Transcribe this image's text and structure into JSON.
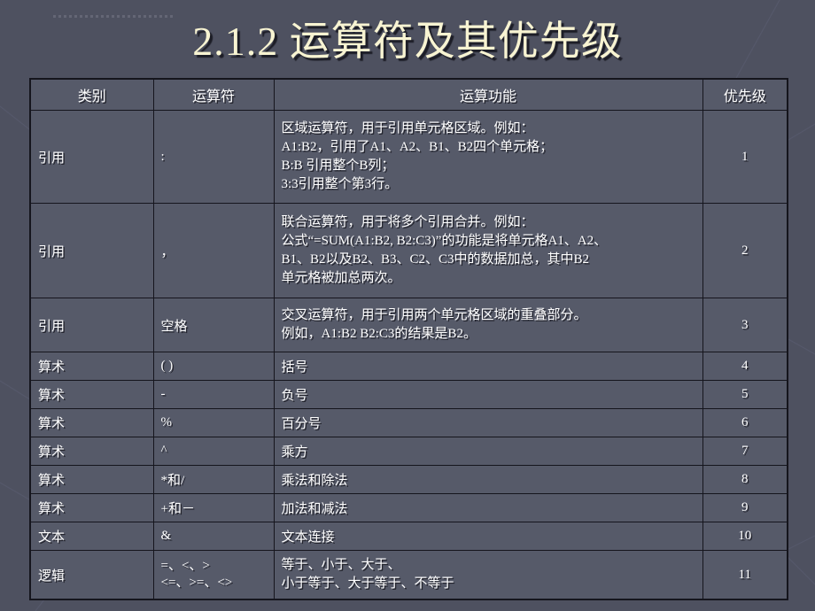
{
  "slide": {
    "title": "2.1.2  运算符及其优先级",
    "title_color": "#f8f4d2",
    "background_color": "#4e5160",
    "table_cell_color": "#565a69",
    "border_color": "#15151d"
  },
  "table": {
    "headers": [
      "类别",
      "运算符",
      "运算功能",
      "优先级"
    ],
    "rows": [
      {
        "category": "引用",
        "operator": ":",
        "function": "区域运算符，用于引用单元格区域。例如：\nA1:B2，引用了A1、A2、B1、B2四个单元格；\nB:B 引用整个B列；\n3:3引用整个第3行。",
        "priority": "1"
      },
      {
        "category": "引用",
        "operator": "，",
        "function": "联合运算符，用于将多个引用合并。例如：\n  公式“=SUM(A1:B2, B2:C3)”的功能是将单元格A1、A2、\n      B1、B2以及B2、B3、C2、C3中的数据加总，其中B2\n      单元格被加总两次。",
        "priority": "2"
      },
      {
        "category": "引用",
        "operator": "空格",
        "function": "交叉运算符，用于引用两个单元格区域的重叠部分。\n例如，A1:B2 B2:C3的结果是B2。",
        "priority": "3"
      },
      {
        "category": "算术",
        "operator": "( )",
        "function": "括号",
        "priority": "4"
      },
      {
        "category": "算术",
        "operator": "-",
        "function": "负号",
        "priority": "5"
      },
      {
        "category": "算术",
        "operator": "%",
        "function": "百分号",
        "priority": "6"
      },
      {
        "category": "算术",
        "operator": "^",
        "function": "乘方",
        "priority": "7"
      },
      {
        "category": "算术",
        "operator": "*和/",
        "function": "乘法和除法",
        "priority": "8"
      },
      {
        "category": "算术",
        "operator": "+和－",
        "function": "加法和减法",
        "priority": "9"
      },
      {
        "category": "文本",
        "operator": "&",
        "function": "文本连接",
        "priority": "10"
      },
      {
        "category": "逻辑",
        "operator": "=、<、>\n<=、>=、<>",
        "function": "等于、小于、大于、\n小于等于、大于等于、不等于",
        "priority": "11"
      }
    ]
  }
}
